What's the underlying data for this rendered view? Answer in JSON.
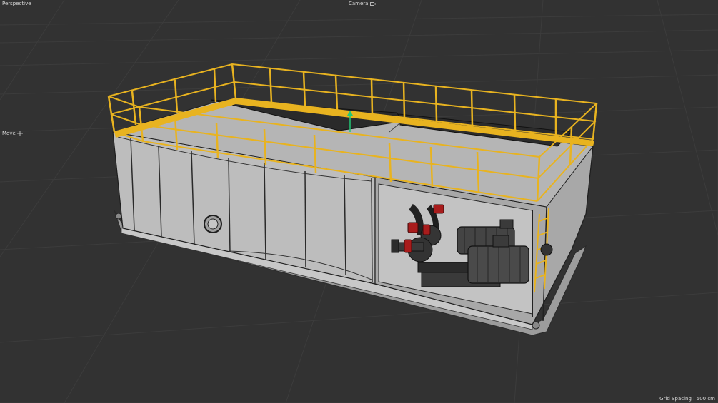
{
  "viewport": {
    "view_label": "Perspective",
    "camera_label": "Camera",
    "camera_icon": "camera-icon",
    "tool_label": "Move",
    "tool_icon": "move-icon",
    "grid_label": "Grid Spacing : 500 cm"
  },
  "colors": {
    "background": "#323232",
    "grid_line": "#3d3d3d",
    "tank_body": "#b4b4b4",
    "railing": "#e8b320",
    "deck": "#2a2a2a",
    "flange": "#b01c1c",
    "axis_y": "#22c776"
  }
}
